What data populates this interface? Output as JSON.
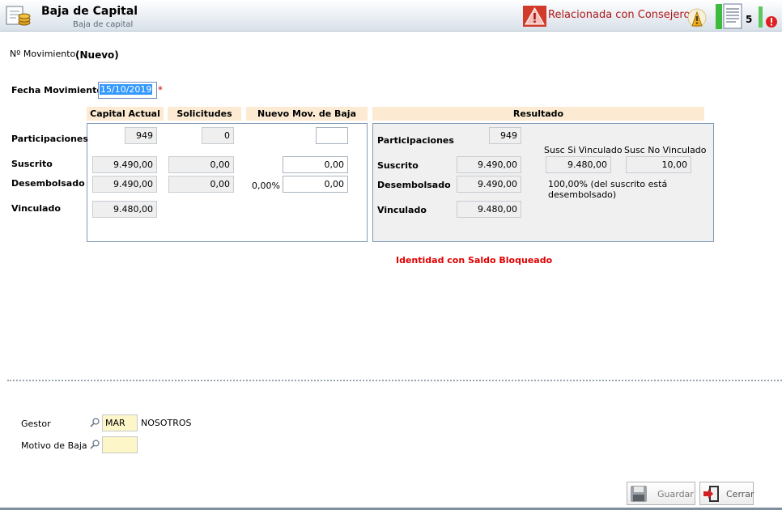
{
  "header": {
    "title": "Baja de Capital",
    "subtitle": "Baja de capital",
    "warning": "Relacionada con Consejeros",
    "doc_count": "5"
  },
  "form": {
    "movimiento_label": "Nº Movimiento",
    "movimiento_value": "(Nuevo)",
    "fecha_label": "Fecha Movimiento",
    "fecha_value": "15/10/2019",
    "required_mark": "*"
  },
  "columns": {
    "capital_actual": "Capital Actual",
    "solicitudes": "Solicitudes",
    "nuevo_mov": "Nuevo Mov. de Baja",
    "resultado": "Resultado"
  },
  "rows": {
    "participaciones": "Participaciones",
    "suscrito": "Suscrito",
    "desembolsado": "Desembolsado",
    "vinculado": "Vinculado"
  },
  "capital_actual": {
    "participaciones": "949",
    "suscrito": "9.490,00",
    "desembolsado": "9.490,00",
    "vinculado": "9.480,00"
  },
  "solicitudes": {
    "participaciones": "0",
    "suscrito": "0,00",
    "desembolsado": "0,00"
  },
  "nuevo_mov": {
    "participaciones": "",
    "suscrito": "0,00",
    "desembolsado_pct": "0,00%",
    "desembolsado": "0,00"
  },
  "resultado": {
    "participaciones_label": "Participaciones",
    "suscrito_label": "Suscrito",
    "desembolsado_label": "Desembolsado",
    "vinculado_label": "Vinculado",
    "participaciones": "949",
    "suscrito": "9.490,00",
    "desembolsado": "9.490,00",
    "vinculado": "9.480,00",
    "susc_si_label": "Susc Si Vinculado",
    "susc_no_label": "Susc No Vinculado",
    "susc_si": "9.480,00",
    "susc_no": "10,00",
    "note_line1": "100,00% (del suscrito está",
    "note_line2": "desembolsado)"
  },
  "message": "Identidad con Saldo Bloqueado",
  "bottom": {
    "gestor_label": "Gestor",
    "gestor_code": "MAR",
    "gestor_name": "NOSOTROS",
    "motivo_label": "Motivo de Baja",
    "motivo_value": ""
  },
  "buttons": {
    "guardar": "Guardar",
    "cerrar": "Cerrar"
  },
  "colors": {
    "header_bg": "#e9eef3",
    "column_header_bg": "#fcebd2",
    "panel_border": "#7f9ab7",
    "warning_red": "#b01818",
    "message_red": "#e00000",
    "input_yellow": "#fdf6c8"
  }
}
